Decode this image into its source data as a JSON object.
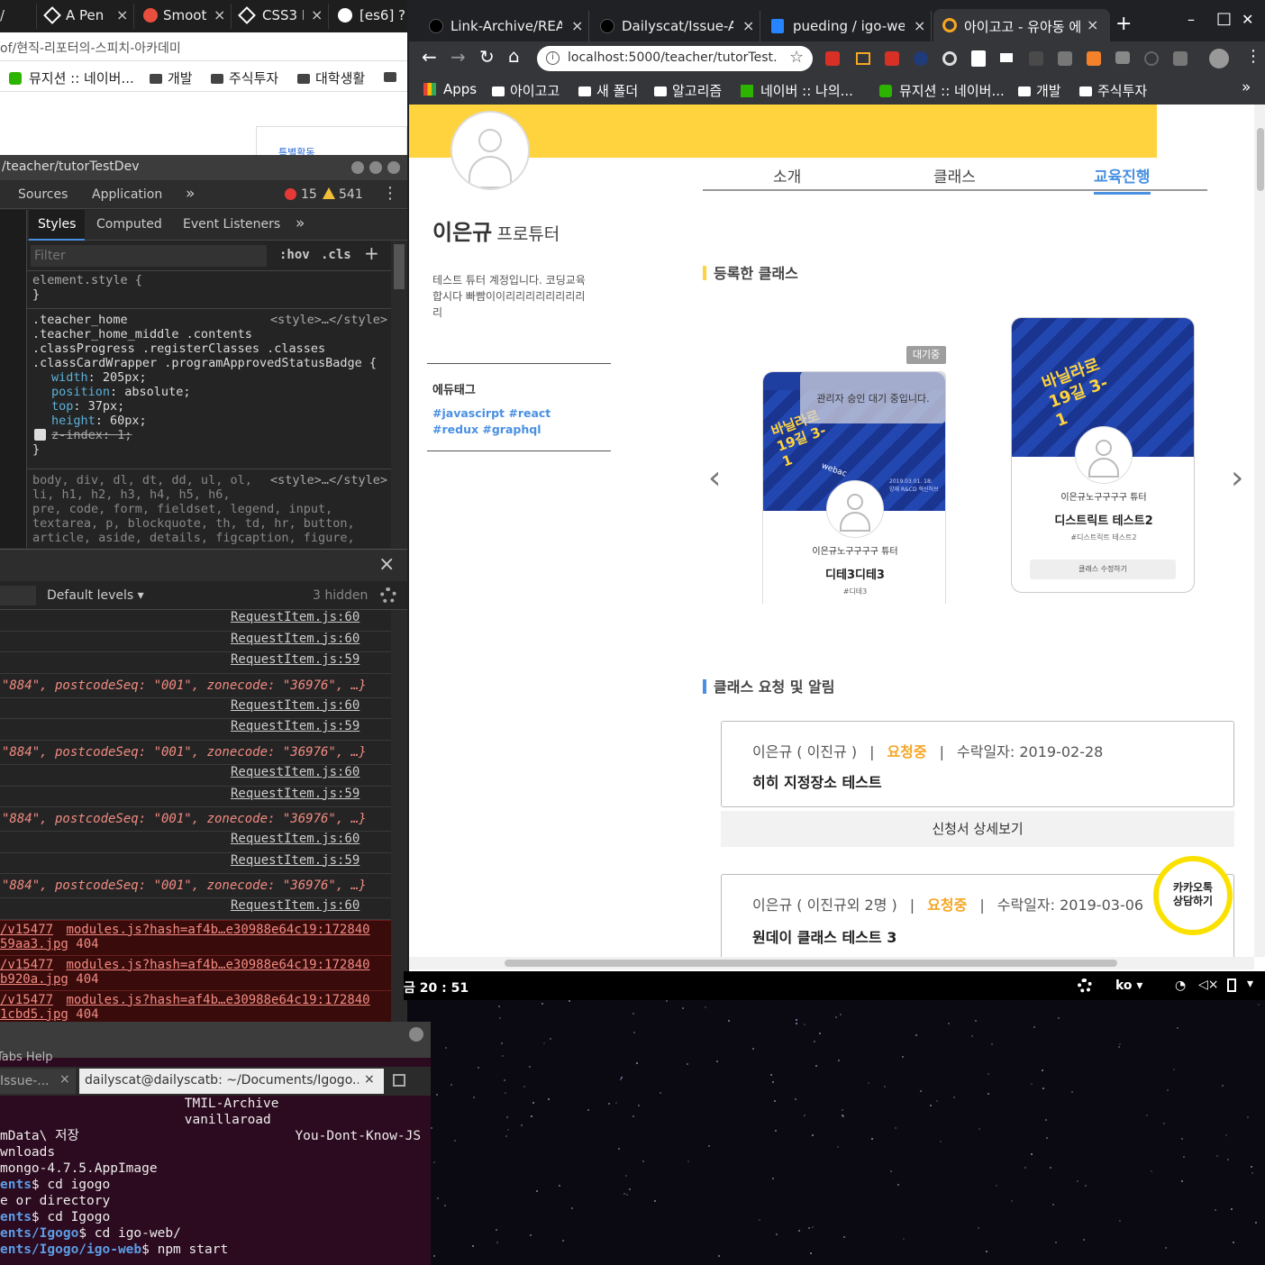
{
  "left_browser": {
    "tabs": [
      {
        "label": "A Pen"
      },
      {
        "label": "Smoot"
      },
      {
        "label": "CSS3 E"
      },
      {
        "label": "[es6] ?"
      }
    ],
    "tab_close": "×",
    "url_tail": "of/현직-리포터의-스피치-아카데미",
    "bookmarks": [
      "뮤지션 :: 네이버...",
      "개발",
      "주식투자",
      "대학생활"
    ],
    "page_snippet": "특별활동"
  },
  "devtools": {
    "title": "/teacher/tutorTestDev",
    "panels": [
      "Sources",
      "Application"
    ],
    "more": "»",
    "errors": "15",
    "warnings": "541",
    "subtabs": [
      "Styles",
      "Computed",
      "Event Listeners"
    ],
    "filter_placeholder": "Filter",
    "hov": ":hov",
    "cls": ".cls",
    "plus": "+",
    "element_style": "element.style {",
    "brace_close": "}",
    "rule_selector": [
      ".teacher_home",
      ".teacher_home_middle .contents",
      ".classProgress .registerClasses .classes",
      ".classCardWrapper .programApprovedStatusBadge {"
    ],
    "rule_source": "<style>…</style>",
    "props": [
      {
        "name": "width",
        "value": "205px;"
      },
      {
        "name": "position",
        "value": "absolute;"
      },
      {
        "name": "top",
        "value": "37px;"
      },
      {
        "name": "height",
        "value": "60px;"
      }
    ],
    "disabled_prop": "z-index: 1;",
    "reset_selector": [
      "body, div, dl, dt, dd, ul, ol,",
      "li, h1, h2, h3, h4, h5, h6,",
      "pre, code, form, fieldset, legend, input,",
      "textarea, p, blockquote, th, td, hr, button,",
      "article, aside, details, figcaption, figure,"
    ],
    "console": {
      "close": "×",
      "levels": "Default levels ▾",
      "hidden": "3 hidden",
      "lines": [
        {
          "src": "RequestItem.js:60"
        },
        {
          "src": "RequestItem.js:60"
        },
        {
          "src": "RequestItem.js:59"
        },
        {
          "obj": "\"884\", postcodeSeq: \"001\", zonecode: \"36976\", …}"
        },
        {
          "src": "RequestItem.js:60"
        },
        {
          "src": "RequestItem.js:59"
        },
        {
          "obj": "\"884\", postcodeSeq: \"001\", zonecode: \"36976\", …}"
        },
        {
          "src": "RequestItem.js:60"
        },
        {
          "src": "RequestItem.js:59"
        },
        {
          "obj": "\"884\", postcodeSeq: \"001\", zonecode: \"36976\", …}"
        },
        {
          "src": "RequestItem.js:60"
        },
        {
          "src": "RequestItem.js:59"
        },
        {
          "obj": "\"884\", postcodeSeq: \"001\", zonecode: \"36976\", …}"
        },
        {
          "src": "RequestItem.js:60"
        }
      ],
      "errors": [
        {
          "a": "/v15477",
          "b": "modules.js?hash=af4b…e30988e64c19:172840",
          "c": "59aa3.jpg",
          "d": "404"
        },
        {
          "a": "/v15477",
          "b": "modules.js?hash=af4b…e30988e64c19:172840",
          "c": "b920a.jpg",
          "d": "404"
        },
        {
          "a": "/v15477",
          "b": "modules.js?hash=af4b…e30988e64c19:172840",
          "c": "1cbd5.jpg",
          "d": "404"
        }
      ]
    }
  },
  "terminal": {
    "menu": "Tabs  Help",
    "tab1": "Issue-...",
    "tab2": "dailyscat@dailyscatb: ~/Documents/Igogo...",
    "close": "×",
    "lines": [
      [
        "",
        "",
        " TMIL-Archive"
      ],
      [
        "",
        "",
        " vanillaroad"
      ],
      [
        "",
        "mData\\ 저장",
        "     You-Dont-Know-JS"
      ],
      [
        "",
        "wnloads",
        ""
      ],
      [
        "",
        "mongo-4.7.5.AppImage",
        ""
      ],
      [
        "ents",
        "$ cd igogo",
        ""
      ],
      [
        "",
        "e or directory",
        ""
      ],
      [
        "ents",
        "$ cd Igogo",
        ""
      ],
      [
        "ents/Igogo",
        "$ cd igo-web/",
        ""
      ],
      [
        "ents/Igogo/igo-web",
        "$ npm start",
        ""
      ]
    ]
  },
  "right_browser": {
    "tabs": [
      {
        "label": "Link-Archive/READ"
      },
      {
        "label": "Dailyscat/Issue-Ar"
      },
      {
        "label": "pueding / igo-web"
      },
      {
        "label": "아이고고 - 유아동 에"
      }
    ],
    "tab_close": "×",
    "new_tab": "+",
    "window": {
      "min": "–",
      "max": "□",
      "close": "✕"
    },
    "url": "localhost:5000/teacher/tutorTest…",
    "bookmarks": [
      "Apps",
      "아이고고",
      "새 폴더",
      "알고리즘",
      "네이버 :: 나의...",
      "뮤지션 :: 네이버...",
      "개발",
      "주식투자"
    ],
    "more": "»"
  },
  "page": {
    "nav": [
      "소개",
      "클래스",
      "교육진행"
    ],
    "tutor_name": "이은규",
    "tutor_role": "프로튜터",
    "intro": "테스트 튜터 계정입니다. 코딩교육 합시다 빠빰이이리리리리리리리리리",
    "edutag_title": "에듀태그",
    "tags": "#javascirpt #react #redux #graphql",
    "section1": "등록한 클래스",
    "status_badge": "대기중",
    "pending_notice": "관리자 승인 대기 중입니다.",
    "cards": [
      {
        "banner": "바닐라로 19길 3-1",
        "small": "webac",
        "date": "2019.03.01. 18:\n양재 R&CD 혁신허브",
        "tutor": "이은규노구구구구 튜터",
        "title": "디테3디테3",
        "tag": "#디테3"
      },
      {
        "banner": "바닐라로 19길 3-1",
        "tutor": "이은규노구구구구 튜터",
        "title": "디스트릭트 테스트2",
        "tag": "#디스트릭트 테스트2",
        "button": "클래스 수정하기"
      }
    ],
    "arrow_left": "‹",
    "arrow_right": "›",
    "section2": "클래스 요청 및 알림",
    "requests": [
      {
        "requester": "이은규 ( 이진규 )",
        "status": "요청중",
        "date": "수락일자: 2019-02-28",
        "title": "히히 지정장소 테스트",
        "button": "신청서 상세보기"
      },
      {
        "requester": "이은규 ( 이진규외 2명 )",
        "status": "요청중",
        "date": "수락일자: 2019-03-06",
        "title": "원데이 클래스 테스트 3"
      }
    ],
    "kakao": "카카오톡\n상담하기"
  },
  "taskbar": {
    "clock": "금 20 : 51",
    "lang": "ko ▾",
    "menu": "▾"
  },
  "colors": {
    "accent": "#4a90e2",
    "yellow": "#ffd33d",
    "orange": "#f5a623",
    "kakao": "#fae100",
    "devtools_bg": "#242424",
    "terminal_bg": "#2c0a1f",
    "error_bg": "#3a0b0b"
  }
}
